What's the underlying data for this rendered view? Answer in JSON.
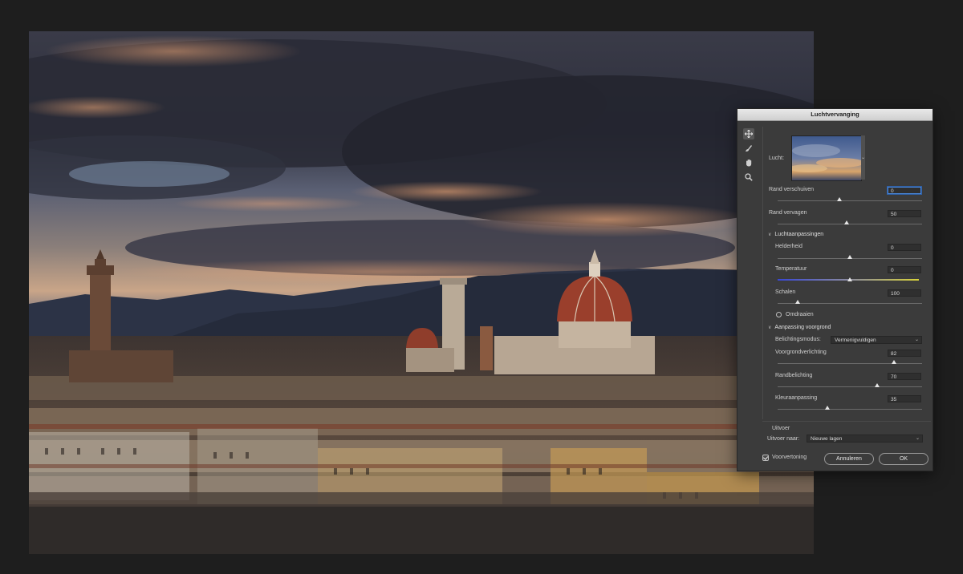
{
  "dialog": {
    "title": "Luchtvervanging",
    "sky_label": "Lucht:",
    "tools": [
      "move-sky-tool",
      "sky-brush-tool",
      "hand-tool",
      "zoom-tool"
    ],
    "fields": {
      "shift_edge": {
        "label": "Rand verschuiven",
        "value": "0"
      },
      "fade_edge": {
        "label": "Rand vervagen",
        "value": "50"
      }
    },
    "sky_adjustments": {
      "header": "Luchtaanpassingen",
      "brightness": {
        "label": "Helderheid",
        "value": "0"
      },
      "temperature": {
        "label": "Temperatuur",
        "value": "0"
      },
      "scale": {
        "label": "Schalen",
        "value": "100"
      },
      "flip_label": "Omdraaien"
    },
    "foreground": {
      "header": "Aanpassing voorgrond",
      "blend_mode_label": "Belichtingsmodus:",
      "blend_mode_value": "Vermenigvuldigen",
      "lighting": {
        "label": "Voorgrondverlichting",
        "value": "82"
      },
      "edge_lighting": {
        "label": "Randbelichting",
        "value": "70"
      },
      "color_adjust": {
        "label": "Kleuraanpassing",
        "value": "35"
      }
    },
    "output": {
      "header": "Uitvoer",
      "output_to_label": "Uitvoer naar:",
      "output_to_value": "Nieuwe lagen"
    },
    "preview_label": "Voorvertoning",
    "preview_checked": true,
    "cancel_label": "Annuleren",
    "ok_label": "OK"
  }
}
